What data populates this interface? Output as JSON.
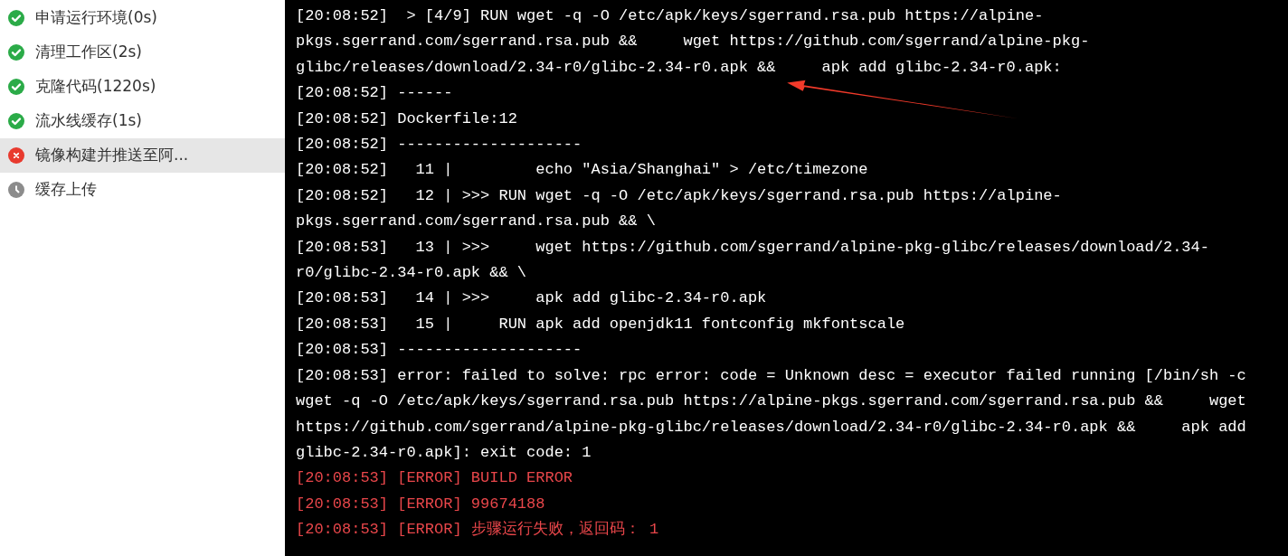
{
  "steps": [
    {
      "label": "申请运行环境(0s)",
      "kind": "success",
      "selected": false
    },
    {
      "label": "清理工作区(2s)",
      "kind": "success",
      "selected": false
    },
    {
      "label": "克隆代码(1220s)",
      "kind": "success",
      "selected": false
    },
    {
      "label": "流水线缓存(1s)",
      "kind": "success",
      "selected": false
    },
    {
      "label": "镜像构建并推送至阿...",
      "kind": "failed",
      "selected": true
    },
    {
      "label": "缓存上传",
      "kind": "pending",
      "selected": false
    }
  ],
  "log": [
    {
      "kind": "info",
      "text": "[20:08:52]  > [4/9] RUN wget -q -O /etc/apk/keys/sgerrand.rsa.pub https://alpine-pkgs.sgerrand.com/sgerrand.rsa.pub &&     wget https://github.com/sgerrand/alpine-pkg-glibc/releases/download/2.34-r0/glibc-2.34-r0.apk &&     apk add glibc-2.34-r0.apk:"
    },
    {
      "kind": "info",
      "text": "[20:08:52] ------"
    },
    {
      "kind": "info",
      "text": "[20:08:52] Dockerfile:12"
    },
    {
      "kind": "info",
      "text": "[20:08:52] --------------------"
    },
    {
      "kind": "info",
      "text": "[20:08:52]   11 |         echo \"Asia/Shanghai\" > /etc/timezone"
    },
    {
      "kind": "info",
      "text": "[20:08:52]   12 | >>> RUN wget -q -O /etc/apk/keys/sgerrand.rsa.pub https://alpine-pkgs.sgerrand.com/sgerrand.rsa.pub && \\"
    },
    {
      "kind": "info",
      "text": "[20:08:53]   13 | >>>     wget https://github.com/sgerrand/alpine-pkg-glibc/releases/download/2.34-r0/glibc-2.34-r0.apk && \\"
    },
    {
      "kind": "info",
      "text": "[20:08:53]   14 | >>>     apk add glibc-2.34-r0.apk"
    },
    {
      "kind": "info",
      "text": "[20:08:53]   15 |     RUN apk add openjdk11 fontconfig mkfontscale"
    },
    {
      "kind": "info",
      "text": "[20:08:53] --------------------"
    },
    {
      "kind": "info",
      "text": "[20:08:53] error: failed to solve: rpc error: code = Unknown desc = executor failed running [/bin/sh -c wget -q -O /etc/apk/keys/sgerrand.rsa.pub https://alpine-pkgs.sgerrand.com/sgerrand.rsa.pub &&     wget https://github.com/sgerrand/alpine-pkg-glibc/releases/download/2.34-r0/glibc-2.34-r0.apk &&     apk add glibc-2.34-r0.apk]: exit code: 1"
    },
    {
      "kind": "error",
      "text": "[20:08:53] [ERROR] BUILD ERROR"
    },
    {
      "kind": "error",
      "text": "[20:08:53] [ERROR] 99674188"
    },
    {
      "kind": "error",
      "text": "[20:08:53] [ERROR] 步骤运行失败，返回码： 1"
    }
  ]
}
